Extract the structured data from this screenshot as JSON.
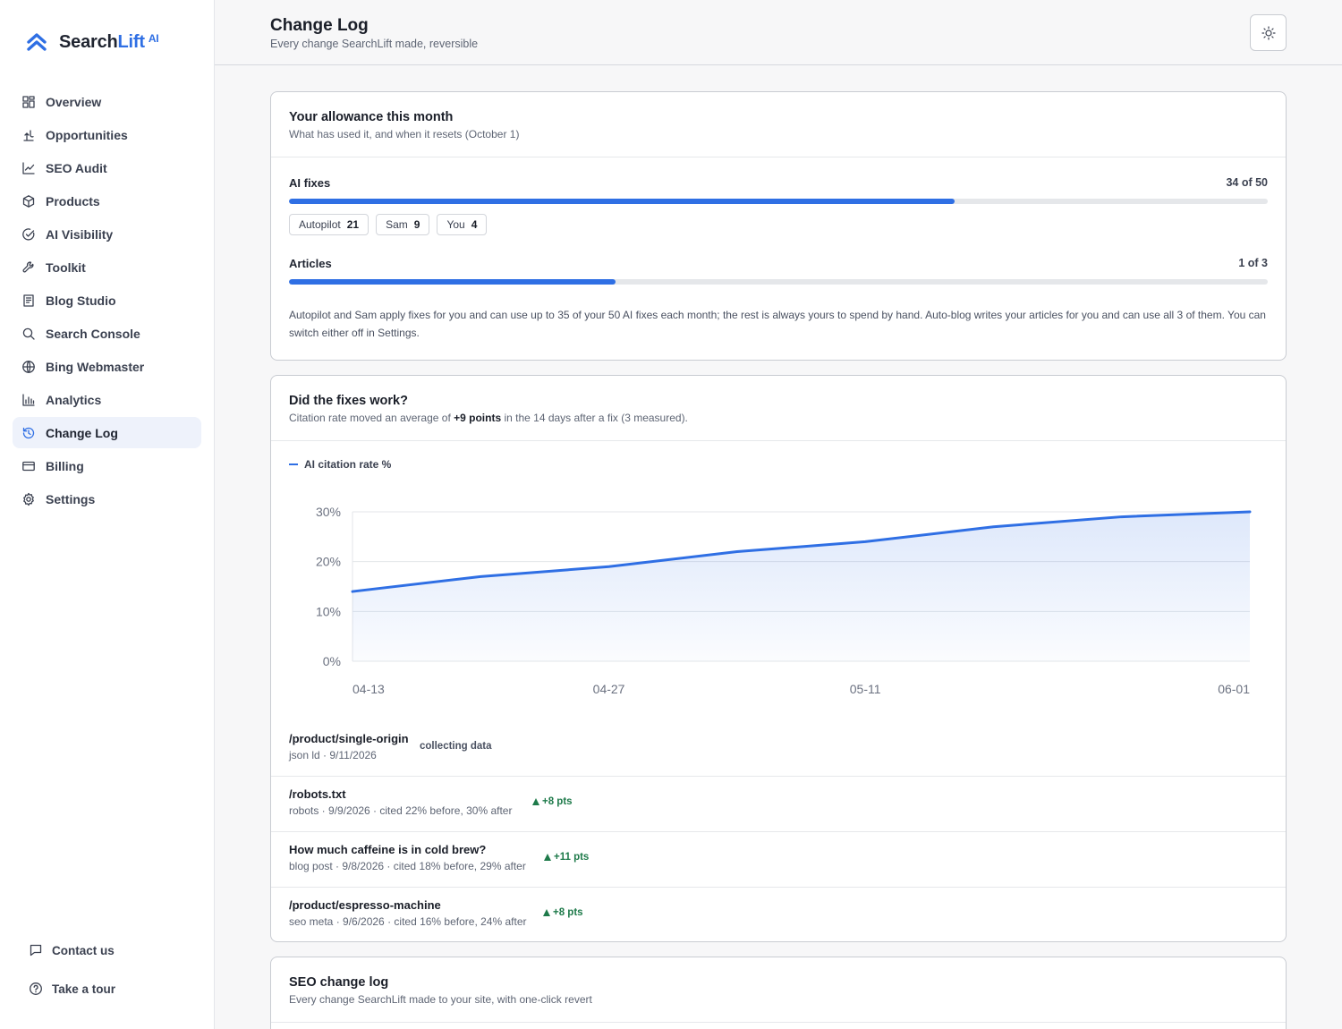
{
  "brand": {
    "name_a": "Search",
    "name_b": "Lift",
    "name_ai": "AI"
  },
  "nav": [
    {
      "label": "Overview",
      "icon": "grid-icon"
    },
    {
      "label": "Opportunities",
      "icon": "opportunities-icon"
    },
    {
      "label": "SEO Audit",
      "icon": "line-chart-icon"
    },
    {
      "label": "Products",
      "icon": "box-icon"
    },
    {
      "label": "AI Visibility",
      "icon": "target-check-icon"
    },
    {
      "label": "Toolkit",
      "icon": "wrench-icon"
    },
    {
      "label": "Blog Studio",
      "icon": "document-icon"
    },
    {
      "label": "Search Console",
      "icon": "search-icon"
    },
    {
      "label": "Bing Webmaster",
      "icon": "globe-icon"
    },
    {
      "label": "Analytics",
      "icon": "bar-chart-icon"
    },
    {
      "label": "Change Log",
      "icon": "history-icon",
      "active": true
    },
    {
      "label": "Billing",
      "icon": "card-icon"
    },
    {
      "label": "Settings",
      "icon": "gear-icon"
    }
  ],
  "footer": {
    "contact": "Contact us",
    "tour": "Take a tour"
  },
  "header": {
    "title": "Change Log",
    "subtitle": "Every change SearchLift made, reversible"
  },
  "allowance": {
    "title": "Your allowance this month",
    "subtitle": "What has used it, and when it resets (October 1)",
    "ai_fixes": {
      "label": "AI fixes",
      "value_text": "34 of 50",
      "used": 34,
      "total": 50
    },
    "chips": [
      {
        "label": "Autopilot",
        "count": "21"
      },
      {
        "label": "Sam",
        "count": "9"
      },
      {
        "label": "You",
        "count": "4"
      }
    ],
    "articles": {
      "label": "Articles",
      "value_text": "1 of 3",
      "used": 1,
      "total": 3
    },
    "note": "Autopilot and Sam apply fixes for you and can use up to 35 of your 50 AI fixes each month; the rest is always yours to spend by hand. Auto-blog writes your articles for you and can use all 3 of them. You can switch either off in Settings."
  },
  "fixes": {
    "title": "Did the fixes work?",
    "sub_before": "Citation rate moved an average of ",
    "sub_bold": "+9 points",
    "sub_after": " in the 14 days after a fix (3 measured).",
    "items": [
      {
        "title": "/product/single-origin",
        "meta": "json ld · 9/11/2026",
        "badge": "collecting data",
        "positive": false
      },
      {
        "title": "/robots.txt",
        "meta": "robots · 9/9/2026 · cited 22% before, 30% after",
        "badge": "+8 pts",
        "positive": true
      },
      {
        "title": "How much caffeine is in cold brew?",
        "meta": "blog post · 9/8/2026 · cited 18% before, 29% after",
        "badge": "+11 pts",
        "positive": true
      },
      {
        "title": "/product/espresso-machine",
        "meta": "seo meta · 9/6/2026 · cited 16% before, 24% after",
        "badge": "+8 pts",
        "positive": true
      }
    ]
  },
  "chart_data": {
    "type": "area",
    "series": [
      {
        "name": "AI citation rate %",
        "values": [
          14,
          17,
          19,
          22,
          24,
          27,
          29,
          30
        ]
      }
    ],
    "x": [
      "04-13",
      "04-20",
      "04-27",
      "05-04",
      "05-11",
      "05-18",
      "05-25",
      "06-01"
    ],
    "xticks": [
      "04-13",
      "04-27",
      "05-11",
      "06-01"
    ],
    "yticks": [
      "0%",
      "10%",
      "20%",
      "30%"
    ],
    "ylim": [
      0,
      30
    ],
    "grid": true,
    "legend": "top-left",
    "color": "#2f6fe4"
  },
  "seolog": {
    "title": "SEO change log",
    "subtitle": "Every change SearchLift made to your site, with one-click revert"
  }
}
